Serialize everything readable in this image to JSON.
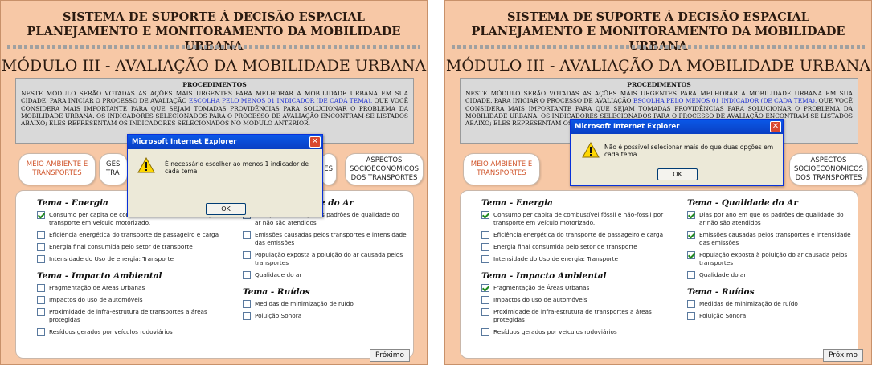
{
  "header": {
    "title_line1": "SISTEMA DE SUPORTE À DECISÃO ESPACIAL",
    "title_line2": "PLANEJAMENTO E MONITORAMENTO DA MOBILIDADE URBANA"
  },
  "module_title": "MÓDULO III - AVALIAÇÃO DA MOBILIDADE URBANA",
  "procedures": {
    "heading": "PROCEDIMENTOS",
    "text_before": "NESTE MÓDULO SERÃO VOTADAS AS AÇÕES MAIS URGENTES PARA MELHORAR A MOBILIDADE URBANA EM SUA CIDADE. PARA INICIAR O PROCESSO DE AVALIAÇÃO",
    "highlight": "ESCOLHA PELO MENOS 01 INDICADOR (DE CADA TEMA),",
    "text_after": "QUE VOCÊ CONSIDERA MAIS IMPORTANTE PARA QUE SEJAM TOMADAS PROVIDÊNCIAS PARA SOLUCIONAR O PROBLEMA DA MOBILIDADE URBANA. OS INDICADORES SELECIONADOS PARA O PROCESSO DE AVALIAÇÃO ENCONTRAM-SE LISTADOS ABAIXO; ELES REPRESENTAM OS INDICADORES SELECIONADOS NO MÓDULO ANTERIOR."
  },
  "tabs": {
    "meio_ambiente": "MEIO AMBIENTE E TRANSPORTES",
    "gestao": "GESTÃO DOS TRANSPORTES",
    "aspectos": "ASPECTOS SOCIOECONOMICOS DOS TRANSPORTES",
    "gestao_partial_l1": "GES",
    "gestao_partial_l2": "TRA",
    "middle_partial": "ES"
  },
  "themes": {
    "energia": {
      "title": "Tema - Energia",
      "items": [
        "Consumo per capita de combustível fóssil e não-fóssil por transporte em veículo motorizado.",
        "Eficiência energética do transporte de passageiro e carga",
        "Energia final consumida pelo setor de transporte",
        "Intensidade do Uso de energia: Transporte"
      ]
    },
    "impacto": {
      "title": "Tema - Impacto Ambiental",
      "items": [
        "Fragmentação de Áreas Urbanas",
        "Impactos do uso de automóveis",
        "Proximidade de infra-estrutura de transportes a áreas protegidas",
        "Resíduos gerados por veículos rodoviários"
      ]
    },
    "qualidade": {
      "title": "Tema - Qualidade do Ar",
      "items": [
        "Dias por ano em que os padrões de qualidade do ar não são atendidos",
        "Emissões causadas pelos transportes e intensidade das emissões",
        "População exposta à poluição do ar causada pelos transportes",
        "Qualidade do ar"
      ]
    },
    "ruidos": {
      "title": "Tema - Ruídos",
      "items": [
        "Medidas de minimização de ruído",
        "Poluição Sonora"
      ]
    }
  },
  "next_button": "Próximo",
  "dialog_left": {
    "title": "Microsoft Internet Explorer",
    "message": "É necessário escolher ao menos 1 indicador de cada tema",
    "ok": "OK",
    "close_glyph": "✕"
  },
  "dialog_right": {
    "title": "Microsoft Internet Explorer",
    "message": "Não é possível selecionar mais do que duas opções em cada tema",
    "ok": "OK",
    "close_glyph": "✕"
  },
  "checked_left": [
    "energia.0"
  ],
  "checked_right": [
    "energia.0",
    "impacto.0",
    "qualidade.0",
    "qualidade.1",
    "qualidade.2"
  ],
  "colors": {
    "panel_bg": "#f7c8a6",
    "active_tab": "#d0542a",
    "highlight_text": "#1d2fd0",
    "dialog_titlebar": "#0a4ad8"
  }
}
